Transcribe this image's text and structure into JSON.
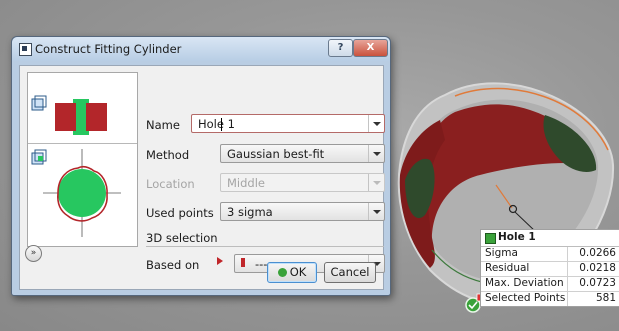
{
  "window": {
    "title": "Construct Fitting Cylinder",
    "help_label": "?",
    "close_label": "X"
  },
  "form": {
    "name_label": "Name",
    "name_value": "Hole 1",
    "method_label": "Method",
    "method_value": "Gaussian best-fit",
    "location_label": "Location",
    "location_value": "Middle",
    "used_points_label": "Used points",
    "used_points_value": "3 sigma",
    "section_title": "3D selection",
    "based_on_label": "Based on",
    "based_on_value": "---"
  },
  "buttons": {
    "ok_label": "OK",
    "cancel_label": "Cancel",
    "expand_label": "»"
  },
  "info_box": {
    "title": "Hole 1",
    "rows": [
      {
        "key": "Sigma",
        "value": "0.0266"
      },
      {
        "key": "Residual",
        "value": "0.0218"
      },
      {
        "key": "Max. Deviation",
        "value": "0.0723"
      },
      {
        "key": "Selected Points",
        "value": "581"
      }
    ]
  },
  "colors": {
    "fit_red": "#8a1f1f",
    "fit_green": "#2f4a2c",
    "preview_green": "#27c760",
    "preview_red": "#b3262a",
    "accent_orange": "#e07a3a"
  },
  "icons": {
    "title": "window-app-icon",
    "expand": "double-chevron-down-icon",
    "ok": "fit-ok-icon",
    "based_on": "pick-marker-icon",
    "info": "cylinder-element-icon"
  }
}
